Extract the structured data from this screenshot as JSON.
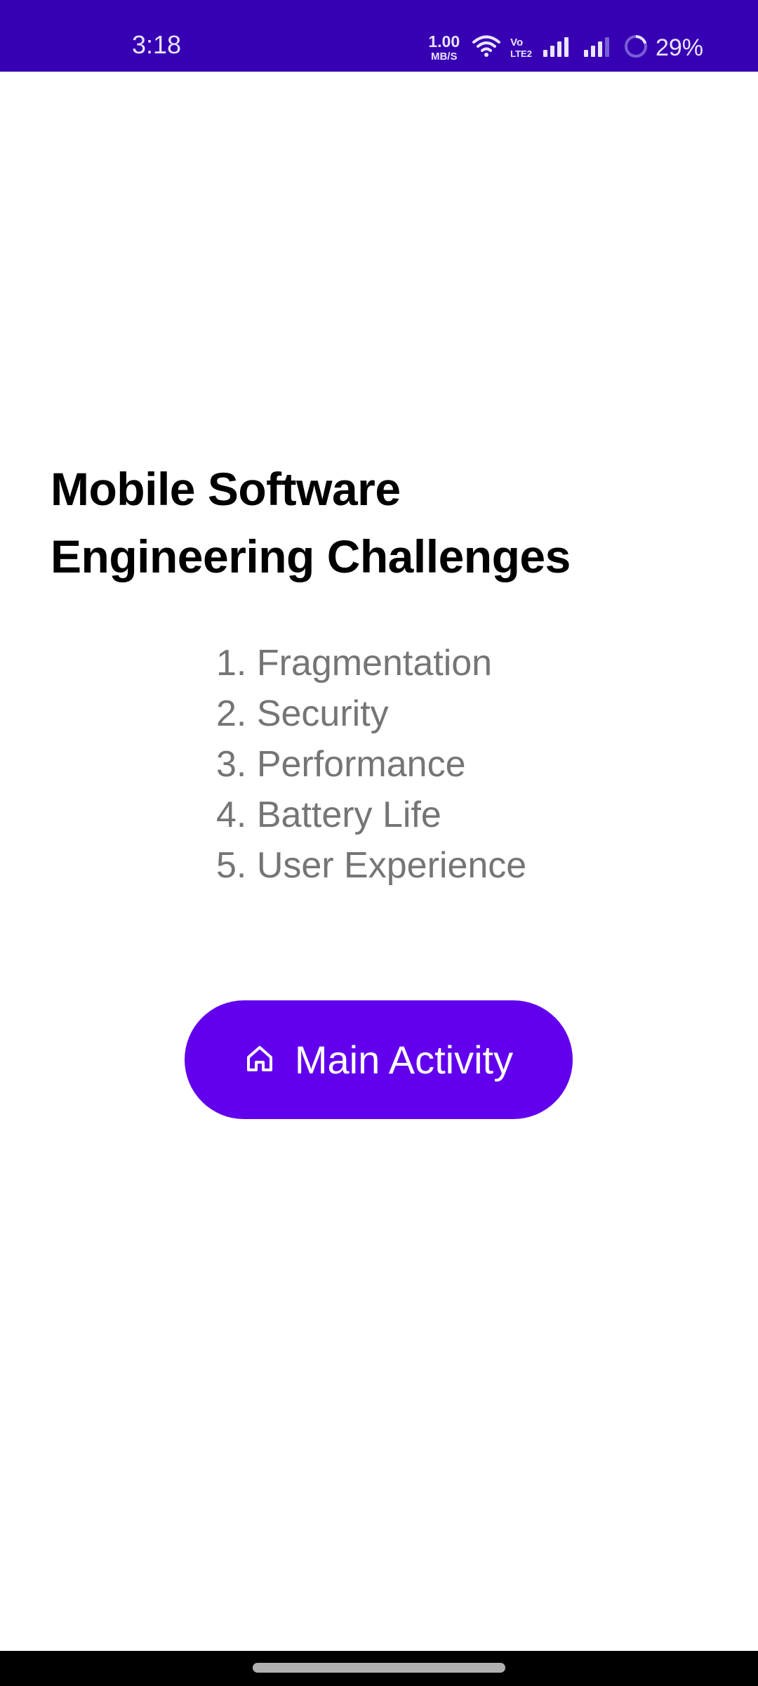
{
  "status_bar": {
    "time": "3:18",
    "net_speed_value": "1.00",
    "net_speed_unit": "MB/S",
    "volte_top": "Vo",
    "volte_bottom": "LTE2",
    "battery_percent": "29%",
    "background_color": "#3700b3"
  },
  "page": {
    "title": "Mobile Software Engineering Challenges",
    "challenges": [
      "1. Fragmentation",
      "2. Security",
      "3. Performance",
      "4. Battery Life",
      "5. User Experience"
    ]
  },
  "main_button": {
    "label": "Main Activity",
    "icon": "home-icon",
    "color": "#6200ee"
  }
}
